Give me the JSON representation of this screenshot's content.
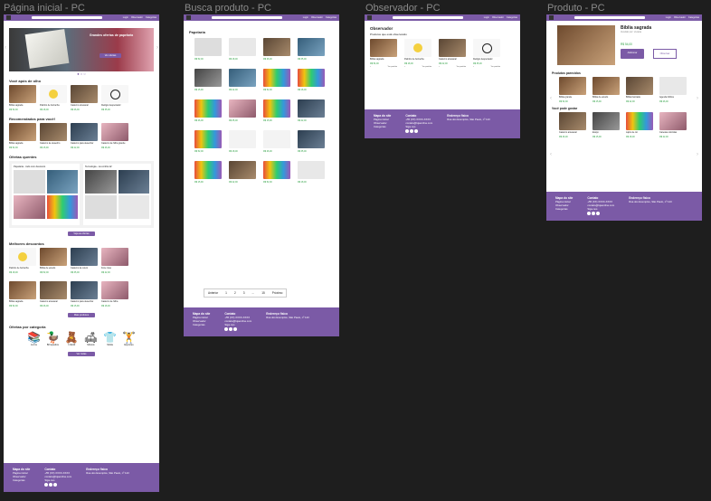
{
  "frames": [
    {
      "label": "Página inicial - PC"
    },
    {
      "label": "Busca produto - PC"
    },
    {
      "label": "Observador - PC"
    },
    {
      "label": "Produto - PC"
    }
  ],
  "nav": {
    "links": [
      "Login",
      "Observador",
      "Categorias"
    ]
  },
  "home": {
    "hero_title": "Grandes ofertas de papelaria",
    "hero_button": "Ver ofertas",
    "sections": {
      "seen": "Você após de olho",
      "recommended": "Recomendados para você!",
      "offers": "Ofertas quentes",
      "best": "Melhores descontos",
      "categories": "Ofertas por categoria"
    },
    "offer_cards": [
      "Papelaria - todo com desconto",
      "Tecnologia - Lá confira lá!"
    ],
    "offer_button": "Veja as ofertas",
    "best_button": "Mais produtos",
    "cat_button": "Ver todas",
    "categories": [
      "Livros",
      "Brinquedos",
      "Infantil",
      "Móveis",
      "Moda",
      "Esportes"
    ]
  },
  "search": {
    "title": "Papelaria",
    "pagination": [
      "Anterior",
      "1",
      "2",
      "3",
      "...",
      "15",
      "Próximo"
    ]
  },
  "observer": {
    "title": "Observador",
    "subtitle": "Produtos que está observando",
    "items": [
      {
        "name": "Bíblia sagrada",
        "price": "R$ 54,00"
      },
      {
        "name": "Patinho de borracha",
        "price": "R$ 18,00"
      },
      {
        "name": "Caderno artesanal",
        "price": "R$ 42,00"
      },
      {
        "name": "Relógio despertador",
        "price": "R$ 35,00"
      }
    ],
    "action": "Ver produto"
  },
  "product": {
    "name": "Bíblia sagrada",
    "subtitle": "Vendido por: Livraria",
    "price": "R$ 54,00",
    "buy": "Adicionar",
    "watch": "Observar",
    "related": "Produtos parecidos",
    "liked": "Você pode gostar"
  },
  "footer": {
    "sitemap": {
      "title": "Mapa do site",
      "items": [
        "Página inicial",
        "Observador",
        "Categorias"
      ]
    },
    "contact": {
      "title": "Contato",
      "items": [
        "+55 (XX) XXXX-XXXX",
        "contato@lojaonline.com"
      ]
    },
    "address": {
      "title": "Endereço físico",
      "items": [
        "Rua dos Exemplos, São Paulo, nº 123"
      ]
    },
    "social": "Siga-nos"
  },
  "prices": [
    "R$ 52,00",
    "R$ 18,00",
    "R$ 26,00",
    "R$ 35,00",
    "R$ 15,90",
    "R$ 22,00"
  ],
  "colors": {
    "brand": "#7b5aa6",
    "price": "#2ea043",
    "canvas": "#1e1e1e"
  }
}
